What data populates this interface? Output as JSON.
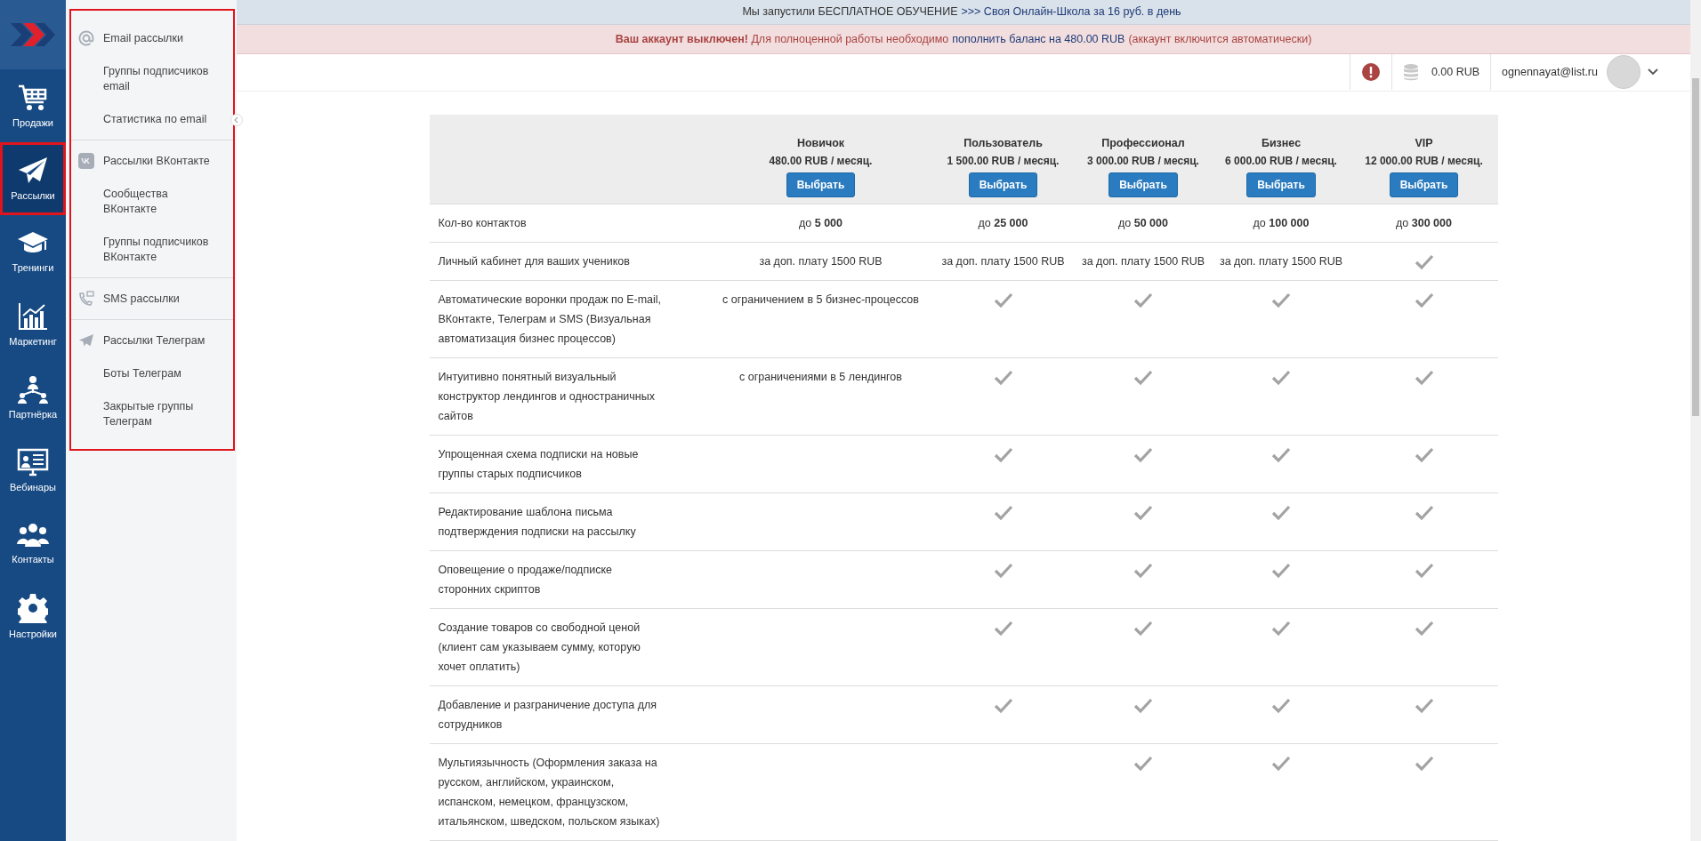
{
  "nav": {
    "items": [
      {
        "label": "Продажи",
        "selected": false,
        "highlighted": false
      },
      {
        "label": "Рассылки",
        "selected": true,
        "highlighted": true
      },
      {
        "label": "Тренинги",
        "selected": false,
        "highlighted": false
      },
      {
        "label": "Маркетинг",
        "selected": false,
        "highlighted": false
      },
      {
        "label": "Партнёрка",
        "selected": false,
        "highlighted": false
      },
      {
        "label": "Вебинары",
        "selected": false,
        "highlighted": false
      },
      {
        "label": "Контакты",
        "selected": false,
        "highlighted": false
      },
      {
        "label": "Настройки",
        "selected": false,
        "highlighted": false
      }
    ]
  },
  "submenu": {
    "highlighted": true,
    "groups": [
      {
        "items": [
          "Email рассылки",
          "Группы подписчиков email",
          "Статистика по email"
        ]
      },
      {
        "items": [
          "Рассылки ВКонтакте",
          "Сообщества ВКонтакте",
          "Группы подписчиков ВКонтакте"
        ]
      },
      {
        "items": [
          "SMS рассылки"
        ]
      },
      {
        "items": [
          "Рассылки Телеграм",
          "Боты Телеграм",
          "Закрытые группы Телеграм"
        ]
      }
    ]
  },
  "banners": [
    {
      "kind": "info",
      "text": "Мы запустили БЕСПЛАТНОЕ ОБУЧЕНИЕ",
      "link": ">>> Своя Онлайн-Школа за 16 руб. в день"
    },
    {
      "kind": "danger",
      "text": "**Ваш аккаунт выключен!** Для полноценной работы необходимо",
      "link": "пополнить баланс на 480.00 RUB",
      "text_after": "(аккаунт включится автоматически)"
    }
  ],
  "header": {
    "balance": "0.00 RUB",
    "email": "ognennayat@list.ru"
  },
  "pricing": {
    "plans": [
      {
        "name": "Новичок",
        "price": "480.00 RUB / месяц.",
        "button": "Выбрать"
      },
      {
        "name": "Пользователь",
        "price": "1 500.00 RUB / месяц.",
        "button": "Выбрать"
      },
      {
        "name": "Профессионал",
        "price": "3 000.00 RUB / месяц.",
        "button": "Выбрать"
      },
      {
        "name": "Бизнес",
        "price": "6 000.00 RUB / месяц.",
        "button": "Выбрать"
      },
      {
        "name": "VIP",
        "price": "12 000.00 RUB / месяц.",
        "button": "Выбрать"
      }
    ],
    "rows": [
      {
        "feature": "Кол-во контактов",
        "cells": [
          {
            "kind": "text",
            "text": "до **5 000**"
          },
          {
            "kind": "text",
            "text": "до **25 000**"
          },
          {
            "kind": "text",
            "text": "до **50 000**"
          },
          {
            "kind": "text",
            "text": "до **100 000**"
          },
          {
            "kind": "text",
            "text": "до **300 000**"
          }
        ]
      },
      {
        "feature": "Личный кабинет для ваших учеников",
        "cells": [
          {
            "kind": "text",
            "text": "за доп. плату 1500 RUB"
          },
          {
            "kind": "text",
            "text": "за доп. плату 1500 RUB"
          },
          {
            "kind": "text",
            "text": "за доп. плату 1500 RUB"
          },
          {
            "kind": "text",
            "text": "за доп. плату 1500 RUB"
          },
          {
            "kind": "check"
          }
        ]
      },
      {
        "feature": "Автоматические воронки продаж по E-mail, ВКонтакте, Телеграм и SMS (Визуальная автоматизация бизнес процессов)",
        "cells": [
          {
            "kind": "text",
            "text": "с ограничением в 5 бизнес-процессов"
          },
          {
            "kind": "check"
          },
          {
            "kind": "check"
          },
          {
            "kind": "check"
          },
          {
            "kind": "check"
          }
        ]
      },
      {
        "feature": "Интуитивно понятный визуальный конструктор лендингов и одностраничных сайтов",
        "cells": [
          {
            "kind": "text",
            "text": "с ограничениями в 5 лендингов"
          },
          {
            "kind": "check"
          },
          {
            "kind": "check"
          },
          {
            "kind": "check"
          },
          {
            "kind": "check"
          }
        ]
      },
      {
        "feature": "Упрощенная схема подписки на новые группы старых подписчиков",
        "cells": [
          {
            "kind": "empty"
          },
          {
            "kind": "check"
          },
          {
            "kind": "check"
          },
          {
            "kind": "check"
          },
          {
            "kind": "check"
          }
        ]
      },
      {
        "feature": "Редактирование шаблона письма подтверждения подписки на рассылку",
        "cells": [
          {
            "kind": "empty"
          },
          {
            "kind": "check"
          },
          {
            "kind": "check"
          },
          {
            "kind": "check"
          },
          {
            "kind": "check"
          }
        ]
      },
      {
        "feature": "Оповещение о продаже/подписке сторонних скриптов",
        "cells": [
          {
            "kind": "empty"
          },
          {
            "kind": "check"
          },
          {
            "kind": "check"
          },
          {
            "kind": "check"
          },
          {
            "kind": "check"
          }
        ]
      },
      {
        "feature": "Создание товаров со свободной ценой (клиент сам указываем сумму, которую хочет оплатить)",
        "cells": [
          {
            "kind": "empty"
          },
          {
            "kind": "check"
          },
          {
            "kind": "check"
          },
          {
            "kind": "check"
          },
          {
            "kind": "check"
          }
        ]
      },
      {
        "feature": "Добавление и разграничение доступа для сотрудников",
        "cells": [
          {
            "kind": "empty"
          },
          {
            "kind": "check"
          },
          {
            "kind": "check"
          },
          {
            "kind": "check"
          },
          {
            "kind": "check"
          }
        ]
      },
      {
        "feature": "Мультиязычность (Оформления заказа на русском, английском, украинском, испанском, немецком, французском, итальянском, шведском, польском языках)",
        "cells": [
          {
            "kind": "empty"
          },
          {
            "kind": "empty"
          },
          {
            "kind": "check"
          },
          {
            "kind": "check"
          },
          {
            "kind": "check"
          }
        ]
      }
    ]
  }
}
